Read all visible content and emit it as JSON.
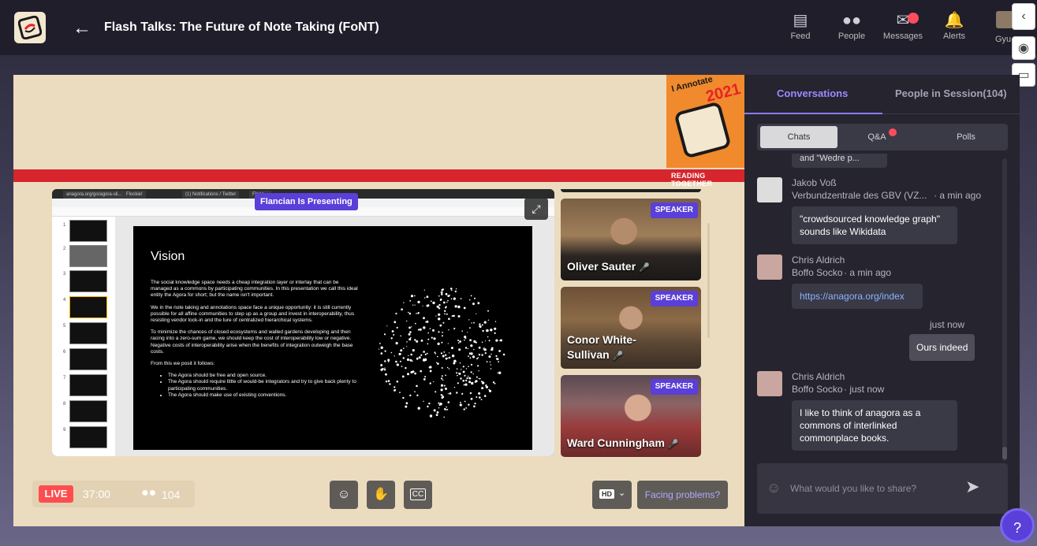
{
  "header": {
    "title": "Flash Talks: The Future of Note Taking (FoNT)",
    "nav": [
      {
        "label": "Feed",
        "icon": "feed-icon"
      },
      {
        "label": "People",
        "icon": "people-icon"
      },
      {
        "label": "Messages",
        "icon": "messages-icon"
      },
      {
        "label": "Alerts",
        "icon": "bell-icon"
      }
    ],
    "user_label": "Gyu"
  },
  "event_badge": {
    "brand": "I Annotate",
    "year": "2021",
    "tagline": "READING TOGETHER"
  },
  "presentation": {
    "presenting_label": "Flancian Is Presenting",
    "browser_tabs": [
      "anagora.org/go/agora-sli...",
      "Flockie!",
      "(1) Notifications / Twitter",
      "Flanc..."
    ],
    "slide": {
      "title": "Vision",
      "paragraphs": [
        "The social knowledge space needs a cheap integration layer or interlay that can be managed as a commons by participating communities. In this presentation we call this ideal entity the Agora for short; but the name isn't important.",
        "We in the note taking and annotations space face a unique opportunity: it is still currently possible for all affine communities to step up as a group and invest in interoperability, thus resisting vendor lock-in and the lure of centralized hierarchical systems.",
        "To minimize the chances of closed ecosystems and walled gardens developing and then racing into a zero-sum game, we should keep the cost of interoperability low or negative. Negative costs of interoperability arise when the benefits of integration outweigh the base costs.",
        "From this we posit it follows:"
      ],
      "bullets": [
        "The Agora should be free and open source.",
        "The Agora should require little of would-be integrators and try to give back plenty to participating communities.",
        "The Agora should make use of existing conventions."
      ]
    }
  },
  "speakers": [
    {
      "badge": "SPEAKER",
      "name": "Oliver Sauter"
    },
    {
      "badge": "SPEAKER",
      "name": "Conor White-Sullivan"
    },
    {
      "badge": "SPEAKER",
      "name": "Ward Cunningham"
    }
  ],
  "controls": {
    "live_label": "LIVE",
    "timer": "37:00",
    "attendee_count": "104",
    "hd_label": "HD",
    "facing_problems": "Facing problems?"
  },
  "panel": {
    "tabs": [
      "Conversations",
      "People in Session(104)"
    ],
    "segments": [
      "Chats",
      "Q&A",
      "Polls"
    ],
    "truncated_message": "and \"Wedre p...",
    "messages": [
      {
        "name": "Jakob Voß",
        "org": "Verbundzentrale des GBV (VZ...",
        "time": "· a min ago",
        "text": "\"crowdsourced knowledge graph\" sounds like Wikidata"
      },
      {
        "name": "Chris Aldrich",
        "org": "Boffo Socko",
        "time": "· a min ago",
        "text": "https://anagora.org/index"
      },
      {
        "name": "Chris Aldrich",
        "org": "Boffo Socko",
        "time": "· just now",
        "text": "I like to think of anagora as a commons of interlinked commonplace books."
      }
    ],
    "own_message": {
      "time": "just now",
      "text": "Ours indeed"
    },
    "input_placeholder": "What would you like to share?"
  },
  "help_label": "?"
}
